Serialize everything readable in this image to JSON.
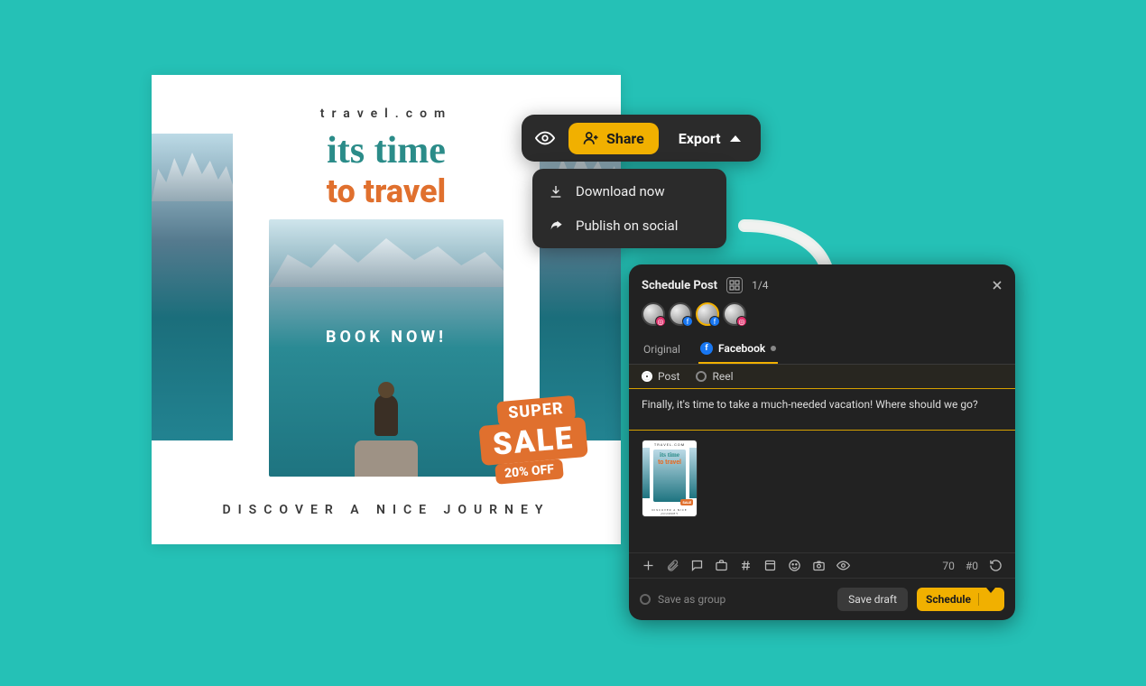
{
  "design": {
    "site": "travel.com",
    "script_line": "its time",
    "main_line": "to travel",
    "book_now": "BOOK NOW!",
    "sale_super": "SUPER",
    "sale_sale": "SALE",
    "sale_off": "20% OFF",
    "footer": "DISCOVER A NICE JOURNEY"
  },
  "toolbar": {
    "share_label": "Share",
    "export_label": "Export"
  },
  "dropdown": {
    "download": "Download now",
    "publish": "Publish on social"
  },
  "panel": {
    "title": "Schedule Post",
    "counter": "1/4",
    "tabs": {
      "original": "Original",
      "facebook": "Facebook"
    },
    "post_types": {
      "post": "Post",
      "reel": "Reel"
    },
    "post_text": "Finally, it's time to take a much-needed vacation! Where should we go?",
    "char_count": "70",
    "tag_count": "#0",
    "save_group": "Save as group",
    "save_draft": "Save draft",
    "schedule": "Schedule"
  },
  "thumb": {
    "site": "TRAVEL.COM",
    "script": "its time",
    "main": "to travel",
    "sale": "SALE",
    "footer": "DISCOVER A NICE JOURNEY"
  }
}
